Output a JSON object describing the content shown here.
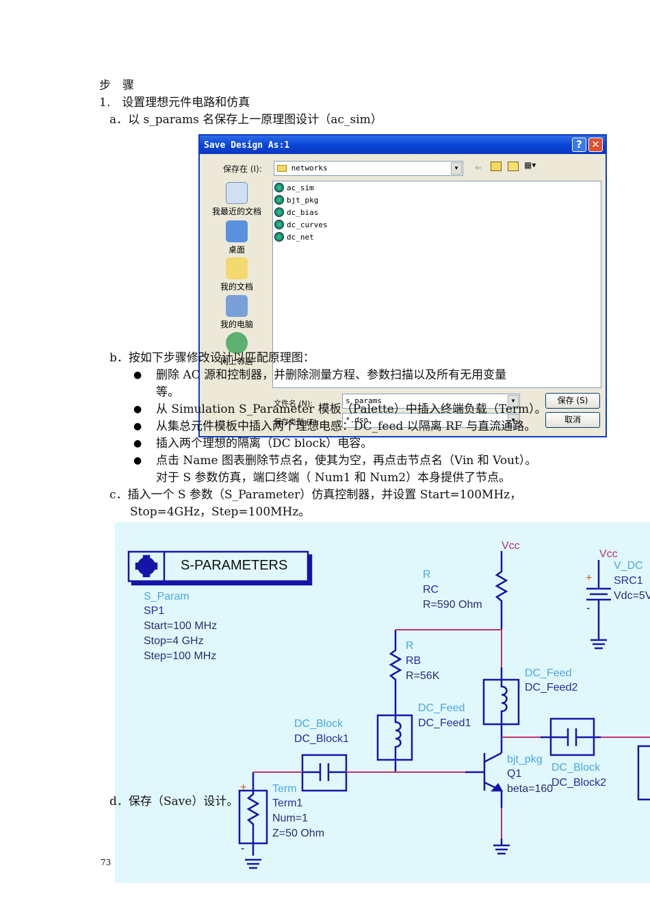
{
  "doc": {
    "heading": "步　骤",
    "step1": "1.　设置理想元件电路和仿真",
    "step_a": "a．以 s_params 名保存上一原理图设计（ac_sim）",
    "step_b": "b．按如下步骤修改设计以匹配原理图：",
    "bullets": [
      "删除 AC 源和控制器，并删除测量方程、参数扫描以及所有无用变量",
      "等。",
      "从 Simulation S_Parameter 模板（Palette）中插入终端负载（Term）。",
      "从集总元件模板中插入两个理想电感：DC_feed 以隔离 RF 与直流通路。",
      "插入两个理想的隔离（DC block）电容。",
      "点击 Name 图表删除节点名，使其为空，再点击节点名（Vin 和 Vout）。",
      "对于 S 参数仿真，端口终端（ Num1 和 Num2）本身提供了节点。"
    ],
    "step_c": "c．插入一个 S 参数（S_Parameter）仿真控制器，并设置 Start=100MHz，",
    "step_c2": "Stop=4GHz，Step=100MHz。",
    "step_d": "d．保存（Save）设计。",
    "page_number": "73"
  },
  "dialog": {
    "title": "Save Design As:1",
    "save_in_label": "保存在 (I):",
    "save_in_value": "networks",
    "places": [
      "我最近的文档",
      "桌面",
      "我的文档",
      "我的电脑",
      "网上邻居"
    ],
    "files": [
      "ac_sim",
      "bjt_pkg",
      "dc_bias",
      "dc_curves",
      "dc_net"
    ],
    "filename_label": "文件名 (N):",
    "filename_value": "s_params",
    "filetype_label": "保存类型 (T):",
    "filetype_value": "*.dsn",
    "save_button": "保存 (S)",
    "cancel_button": "取消",
    "help_button": "?",
    "close_button": "✕"
  },
  "schematic": {
    "sparam_title": "S-PARAMETERS",
    "sparam": [
      "S_Param",
      "SP1",
      "Start=100 MHz",
      "Stop=4 GHz",
      "Step=100 MHz"
    ],
    "rc": [
      "R",
      "RC",
      "R=590 Ohm"
    ],
    "rb": [
      "R",
      "RB",
      "R=56K"
    ],
    "vcc": "Vcc",
    "vdc": [
      "V_DC",
      "SRC1",
      "Vdc=5V"
    ],
    "feed2": [
      "DC_Feed",
      "DC_Feed2"
    ],
    "feed1": [
      "DC_Feed",
      "DC_Feed1"
    ],
    "block1": [
      "DC_Block",
      "DC_Block1"
    ],
    "block2": [
      "DC_Block",
      "DC_Block2"
    ],
    "bjt": [
      "bjt_pkg",
      "Q1",
      "beta=160"
    ],
    "term": [
      "Term",
      "Term1",
      "Num=1",
      "Z=50 Ohm"
    ],
    "colors": {
      "wire": "#1414a8",
      "net": "#c0306a",
      "bg": "#e0f8fc"
    }
  }
}
